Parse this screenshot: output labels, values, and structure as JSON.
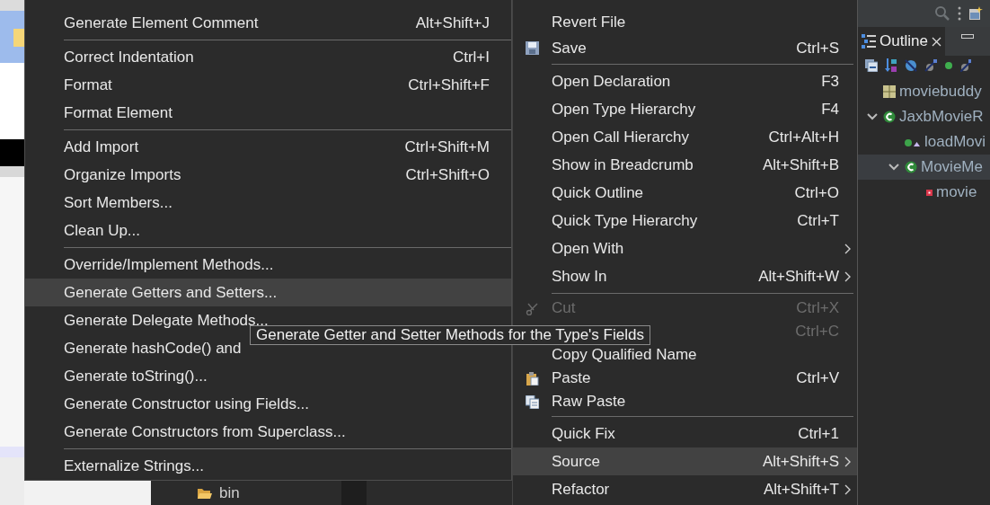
{
  "source_submenu": {
    "items": [
      {
        "kind": "item",
        "label": "Generate Element Comment",
        "shortcut": "Alt+Shift+J",
        "selected": false
      },
      {
        "kind": "separator"
      },
      {
        "kind": "item",
        "label": "Correct Indentation",
        "shortcut": "Ctrl+I",
        "selected": false
      },
      {
        "kind": "item",
        "label": "Format",
        "shortcut": "Ctrl+Shift+F",
        "selected": false
      },
      {
        "kind": "item",
        "label": "Format Element",
        "selected": false
      },
      {
        "kind": "separator"
      },
      {
        "kind": "item",
        "label": "Add Import",
        "shortcut": "Ctrl+Shift+M",
        "selected": false
      },
      {
        "kind": "item",
        "label": "Organize Imports",
        "shortcut": "Ctrl+Shift+O",
        "selected": false
      },
      {
        "kind": "item",
        "label": "Sort Members...",
        "selected": false
      },
      {
        "kind": "item",
        "label": "Clean Up...",
        "selected": false
      },
      {
        "kind": "separator"
      },
      {
        "kind": "item",
        "label": "Override/Implement Methods...",
        "selected": false
      },
      {
        "kind": "item",
        "label": "Generate Getters and Setters...",
        "selected": true
      },
      {
        "kind": "item",
        "label": "Generate Delegate Methods...",
        "selected": false
      },
      {
        "kind": "item",
        "label": "Generate hashCode() and",
        "selected": false
      },
      {
        "kind": "item",
        "label": "Generate toString()...",
        "selected": false
      },
      {
        "kind": "item",
        "label": "Generate Constructor using Fields...",
        "selected": false
      },
      {
        "kind": "item",
        "label": "Generate Constructors from Superclass...",
        "selected": false
      },
      {
        "kind": "separator"
      },
      {
        "kind": "item",
        "label": "Externalize Strings...",
        "selected": false
      }
    ]
  },
  "context_menu": {
    "items": [
      {
        "kind": "item",
        "label": "Revert File",
        "selected": false,
        "disabled": false,
        "submenu": false
      },
      {
        "kind": "save",
        "label": "Save",
        "shortcut": "Ctrl+S",
        "selected": false,
        "disabled": false,
        "submenu": false
      },
      {
        "kind": "separator"
      },
      {
        "kind": "item",
        "label": "Open Declaration",
        "shortcut": "F3",
        "selected": false,
        "disabled": false,
        "submenu": false
      },
      {
        "kind": "item",
        "label": "Open Type Hierarchy",
        "shortcut": "F4",
        "selected": false,
        "disabled": false,
        "submenu": false
      },
      {
        "kind": "item",
        "label": "Open Call Hierarchy",
        "shortcut": "Ctrl+Alt+H",
        "selected": false,
        "disabled": false,
        "submenu": false
      },
      {
        "kind": "item",
        "label": "Show in Breadcrumb",
        "shortcut": "Alt+Shift+B",
        "selected": false,
        "disabled": false,
        "submenu": false
      },
      {
        "kind": "item",
        "label": "Quick Outline",
        "shortcut": "Ctrl+O",
        "selected": false,
        "disabled": false,
        "submenu": false
      },
      {
        "kind": "item",
        "label": "Quick Type Hierarchy",
        "shortcut": "Ctrl+T",
        "selected": false,
        "disabled": false,
        "submenu": false
      },
      {
        "kind": "item",
        "label": "Open With",
        "selected": false,
        "disabled": false,
        "submenu": true
      },
      {
        "kind": "item",
        "label": "Show In",
        "shortcut": "Alt+Shift+W",
        "selected": false,
        "disabled": false,
        "submenu": true
      },
      {
        "kind": "separator"
      },
      {
        "kind": "cut",
        "label": "Cut",
        "shortcut": "Ctrl+X",
        "selected": false,
        "disabled": true,
        "submenu": false
      },
      {
        "kind": "copy",
        "shortcut": "Ctrl+C",
        "selected": false,
        "disabled": true,
        "submenu": false
      },
      {
        "kind": "item",
        "label": "Copy Qualified Name",
        "selected": false,
        "disabled": false,
        "submenu": false
      },
      {
        "kind": "paste",
        "label": "Paste",
        "shortcut": "Ctrl+V",
        "selected": false,
        "disabled": false,
        "submenu": false
      },
      {
        "kind": "raw-paste",
        "label": "Raw Paste",
        "selected": false,
        "disabled": false,
        "submenu": false
      },
      {
        "kind": "separator"
      },
      {
        "kind": "item",
        "label": "Quick Fix",
        "shortcut": "Ctrl+1",
        "selected": false,
        "disabled": false,
        "submenu": false
      },
      {
        "kind": "item",
        "label": "Source",
        "shortcut": "Alt+Shift+S",
        "selected": true,
        "disabled": false,
        "submenu": true
      },
      {
        "kind": "item",
        "label": "Refactor",
        "shortcut": "Alt+Shift+T",
        "selected": false,
        "disabled": false,
        "submenu": true
      }
    ]
  },
  "tooltip": {
    "text": "Generate Getter and Setter Methods for the Type's Fields"
  },
  "project_tree": {
    "items": [
      {
        "kind": "folder",
        "label": "bin"
      }
    ]
  },
  "outline": {
    "tab": {
      "label": "Outline",
      "selected": true
    },
    "items": [
      {
        "kind": "package",
        "label": "moviebuddy",
        "selected": false
      },
      {
        "kind": "class",
        "label": "JaxbMovieR",
        "selected": false,
        "expanded": true,
        "children": [
          {
            "kind": "method",
            "label": "loadMovi",
            "selected": false
          },
          {
            "kind": "class",
            "label": "MovieMe",
            "selected": true,
            "expanded": true,
            "children": [
              {
                "kind": "field",
                "label": "movie",
                "selected": false
              }
            ]
          }
        ]
      }
    ]
  }
}
